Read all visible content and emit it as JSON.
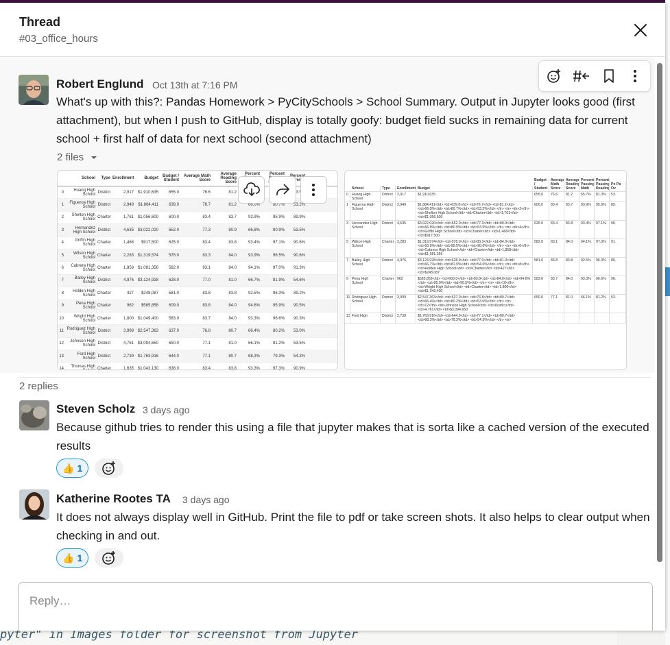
{
  "header": {
    "title": "Thread",
    "channel": "#03_office_hours"
  },
  "parent_message": {
    "author": "Robert Englund",
    "timestamp": "Oct 13th at 7:16 PM",
    "text": "What's up with this?:  Pandas Homework > PyCitySchools > School Summary.  Output in Jupyter looks good (first attachment), but when I push to GitHub, display is totally goofy: budget field sucks in remaining data for current school + first half of data for next school (second attachment)",
    "files_label": "2 files",
    "actions": [
      "add-reaction",
      "reply-in-thread",
      "save",
      "more"
    ]
  },
  "attachment1": {
    "headers": [
      "",
      "School",
      "Type",
      "Enrollment",
      "Budget",
      "Budget / Student",
      "Average Math Score",
      "Average Reading Score",
      "Percent Passing Math",
      "Percent Passing Reading",
      "Percent Overall"
    ],
    "rows": [
      [
        "0",
        "Huang High School",
        "District",
        "2,917",
        "$1,910,635",
        "655.0",
        "76.6",
        "81.2",
        "65.7%",
        "81.3%",
        "53.5%"
      ],
      [
        "1",
        "Figueroa High School",
        "District",
        "2,949",
        "$1,884,411",
        "639.0",
        "76.7",
        "81.2",
        "66.0%",
        "80.7%",
        "53.2%"
      ],
      [
        "2",
        "Shelton High School",
        "Charter",
        "1,761",
        "$1,056,600",
        "600.0",
        "83.4",
        "83.7",
        "93.9%",
        "95.9%",
        "89.9%"
      ],
      [
        "3",
        "Hernandez High School",
        "District",
        "4,635",
        "$3,022,020",
        "652.0",
        "77.3",
        "80.9",
        "66.8%",
        "80.9%",
        "53.5%"
      ],
      [
        "4",
        "Griffin High School",
        "Charter",
        "1,468",
        "$917,500",
        "625.0",
        "83.4",
        "83.8",
        "93.4%",
        "97.1%",
        "90.6%"
      ],
      [
        "5",
        "Wilson High School",
        "Charter",
        "2,283",
        "$1,319,574",
        "578.0",
        "83.3",
        "84.0",
        "93.9%",
        "96.5%",
        "90.6%"
      ],
      [
        "6",
        "Cabrera High School",
        "Charter",
        "1,858",
        "$1,081,356",
        "582.0",
        "83.1",
        "84.0",
        "94.1%",
        "97.0%",
        "91.3%"
      ],
      [
        "7",
        "Bailey High School",
        "District",
        "4,976",
        "$3,124,928",
        "628.0",
        "77.0",
        "81.0",
        "66.7%",
        "81.9%",
        "54.6%"
      ],
      [
        "8",
        "Holden High School",
        "Charter",
        "427",
        "$248,087",
        "581.0",
        "83.8",
        "83.8",
        "92.5%",
        "96.3%",
        "89.2%"
      ],
      [
        "9",
        "Pena High School",
        "Charter",
        "962",
        "$585,858",
        "609.0",
        "83.8",
        "84.0",
        "94.6%",
        "95.9%",
        "90.5%"
      ],
      [
        "10",
        "Wright High School",
        "Charter",
        "1,800",
        "$1,049,400",
        "583.0",
        "83.7",
        "84.0",
        "93.3%",
        "96.6%",
        "90.3%"
      ],
      [
        "11",
        "Rodriguez High School",
        "District",
        "3,999",
        "$2,547,363",
        "637.0",
        "76.8",
        "80.7",
        "66.4%",
        "80.2%",
        "53.0%"
      ],
      [
        "12",
        "Johnson High School",
        "District",
        "4,761",
        "$3,094,650",
        "650.0",
        "77.1",
        "81.0",
        "66.1%",
        "81.2%",
        "53.5%"
      ],
      [
        "13",
        "Ford High School",
        "District",
        "2,739",
        "$1,763,916",
        "644.0",
        "77.1",
        "80.7",
        "68.3%",
        "79.3%",
        "54.3%"
      ],
      [
        "14",
        "Thomas High School",
        "Charter",
        "1,635",
        "$1,043,130",
        "638.0",
        "83.4",
        "83.8",
        "93.3%",
        "97.3%",
        "90.9%"
      ]
    ]
  },
  "attachment2": {
    "headers": [
      "",
      "School",
      "Type",
      "Enrollment",
      "Budget",
      "Budget / Student",
      "Average Math Score",
      "Average Reading Score",
      "Percent Passing Math",
      "Percent Passing Reading",
      "Pe Pa Ov"
    ],
    "rows": [
      [
        "0",
        "Huang High School",
        "District",
        "2,917",
        "$1,910,635",
        "655.0",
        "76.6",
        "81.2",
        "65.7%",
        "81.3%",
        "53."
      ],
      [
        "1",
        "Figueroa High School",
        "District",
        "2,949",
        "$1,884,411</td> <td>639.0</td> <td>76.7</td> <td>81.2</td> <td>66.0%</td> <td>80.7%</td> <td>53.2%</td> </tr> <tr> <th>2</th> <td>Shelton High School</td> <td>Charter</td> <td>1,761</td> <td>$1,056,600",
        "600.0",
        "83.4",
        "83.7",
        "93.9%",
        "95.9%",
        "89."
      ],
      [
        "3",
        "Hernandez High School",
        "District",
        "4,635",
        "$3,022,020</td> <td>652.0</td> <td>77.3</td> <td>80.9</td> <td>66.8%</td> <td>80.9%</td> <td>53.5%</td> </tr> <tr> <th>4</th> <td>Griffin High School</td> <td>Charter</td> <td>1,468</td> <td>$917,500",
        "625.0",
        "83.4",
        "83.8",
        "93.4%",
        "97.1%",
        "90."
      ],
      [
        "5",
        "Wilson High School",
        "Charter",
        "2,283",
        "$1,319,574</td> <td>578.0</td> <td>83.3</td> <td>84.0</td> <td>93.9%</td> <td>96.5%</td> <td>90.6%</td> </tr> <tr> <th>6</th> <td>Cabrera High School</td> <td>Charter</td> <td>1,858</td> <td>$1,081,356",
        "582.0",
        "83.1",
        "84.0",
        "94.1%",
        "97.0%",
        "91."
      ],
      [
        "7",
        "Bailey High School",
        "District",
        "4,976",
        "$3,124,928</td> <td>628.0</td> <td>77.0</td> <td>81.0</td> <td>66.7%</td> <td>81.9%</td> <td>54.6%</td> </tr> <tr> <th>8</th> <td>Holden High School</td> <td>Charter</td> <td>427</td> <td>$248,087",
        "581.0",
        "83.8",
        "83.8",
        "92.5%",
        "96.3%",
        "89."
      ],
      [
        "9",
        "Pena High School",
        "Charter",
        "962",
        "$585,858</td> <td>609.0</td> <td>83.8</td> <td>84.0</td> <td>94.6%</td> <td>95.9%</td> <td>90.5%</td> </tr> <tr> <th>10</th> <td>Wright High School</td> <td>Charter</td> <td>1,800</td> <td>$1,049,400",
        "583.0",
        "83.7",
        "84.0",
        "93.3%",
        "96.6%",
        "90."
      ],
      [
        "11",
        "Rodriguez High School",
        "District",
        "3,999",
        "$2,547,363</td> <td>637.0</td> <td>76.8</td> <td>80.7</td> <td>66.4%</td> <td>80.2%</td> <td>53.0%</td> </tr> <tr> <th>12</th> <td>Johnson High School</td> <td>District</td> <td>4,761</td> <td>$3,094,650",
        "650.0",
        "77.1",
        "81.0",
        "66.1%",
        "81.2%",
        "53."
      ],
      [
        "13",
        "Ford High",
        "District",
        "2,739",
        "$1,763,916</td> <td>644.0</td> <td>77.1</td> <td>80.7</td> <td>68.3%</td> <td>79.3%</td> <td>54.3%</td> </tr> <tr>",
        "",
        "",
        "",
        "",
        "",
        ""
      ]
    ]
  },
  "replies_label": "2 replies",
  "replies": [
    {
      "author": "Steven Scholz",
      "timestamp": "3 days ago",
      "text": "Because github tries to render this using a file that jupyter makes that is sorta like a cached version of the executed results",
      "reaction_emoji": "👍",
      "reaction_count": "1"
    },
    {
      "author": "Katherine Rootes TA",
      "timestamp": "3 days ago",
      "text": "It does not always display well in GitHub.  Print the file to pdf or take screen shots.  It also helps to clear output when checking in and out.",
      "reaction_emoji": "👍",
      "reaction_count": "1"
    }
  ],
  "composer": {
    "placeholder": "Reply…"
  },
  "background_code": "pyter\" in Images folder for screenshot from Jupyter",
  "colors": {
    "aubergine": "#3f0e40",
    "link_blue": "#1264a3",
    "reaction_border": "#1d9bd1"
  }
}
